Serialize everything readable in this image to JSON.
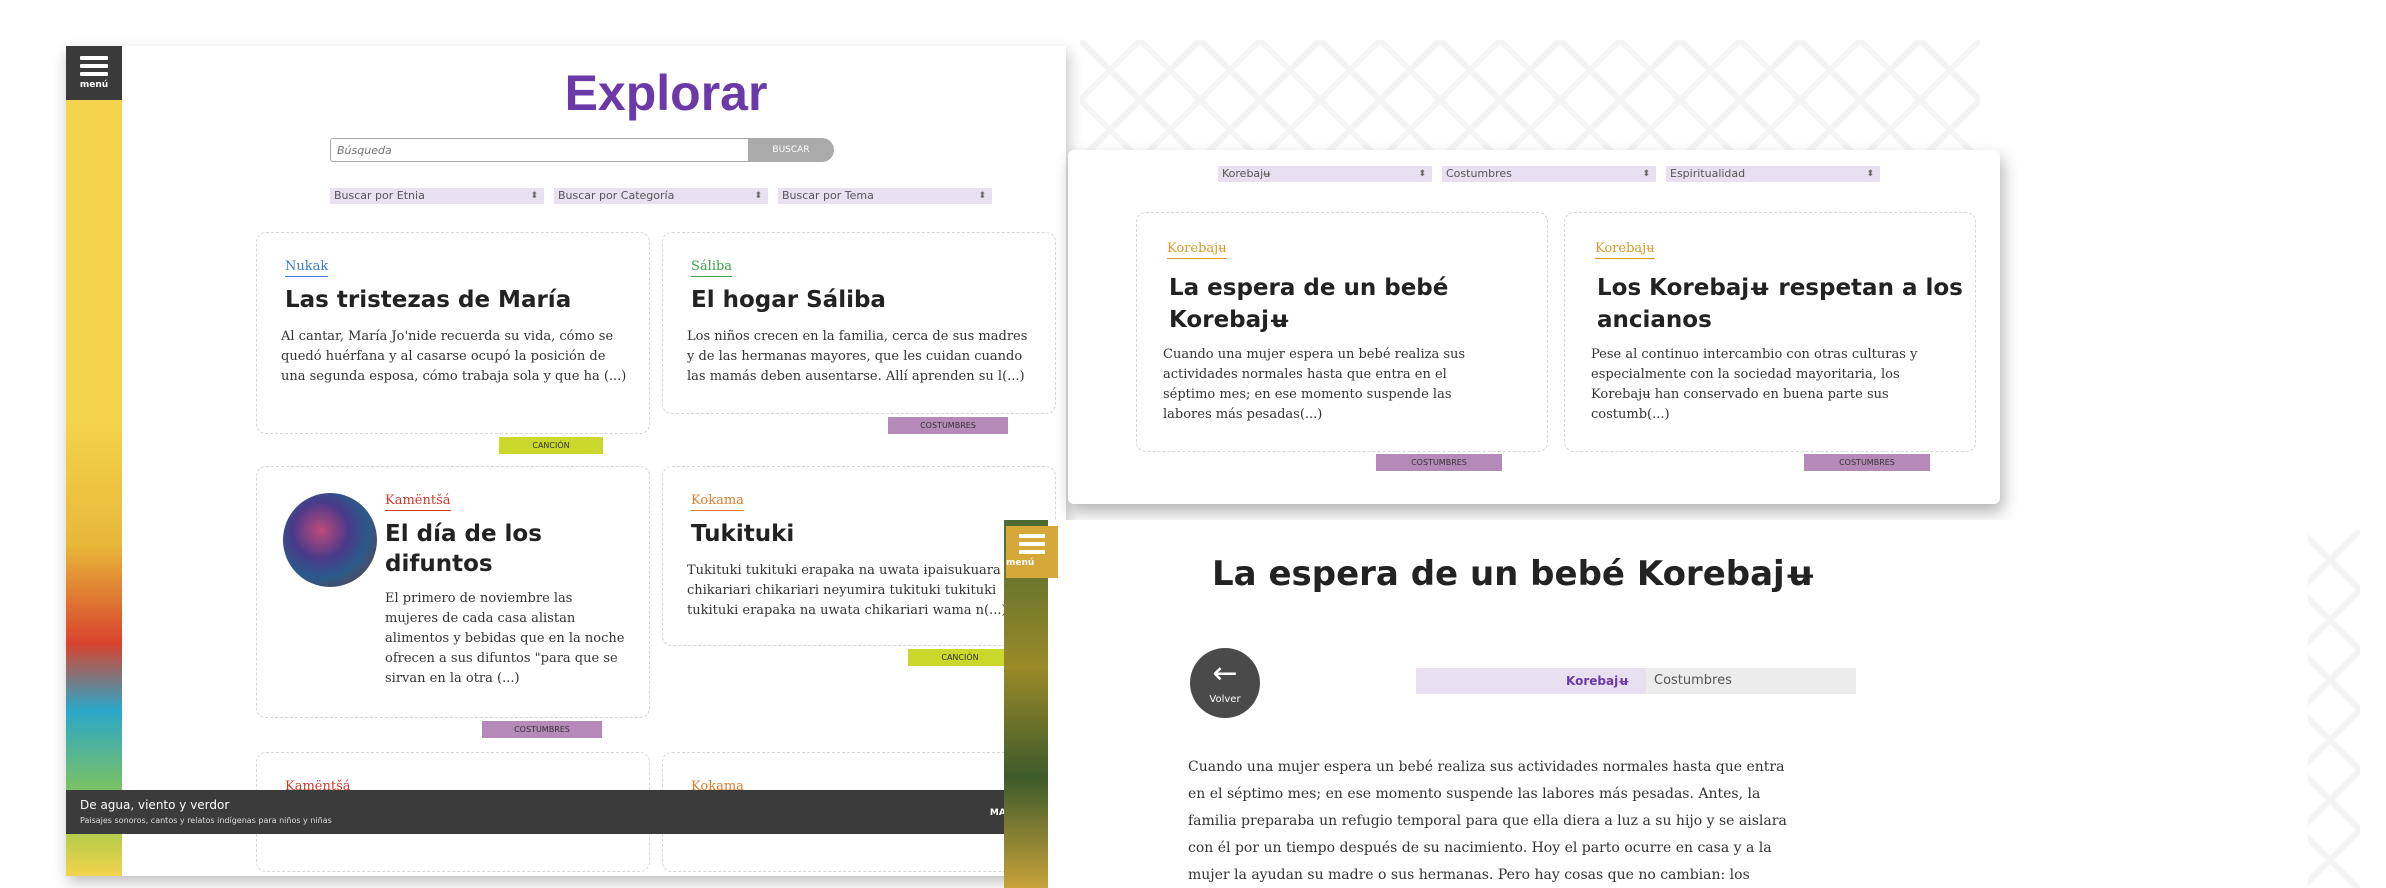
{
  "explore": {
    "menu_label": "menú",
    "title": "Explorar",
    "search_placeholder": "Búsqueda",
    "search_button": "BUSCAR",
    "filters": [
      "Buscar por Etnia",
      "Buscar por Categoría",
      "Buscar por Tema"
    ],
    "cards": [
      {
        "ethnic": "Nukak",
        "title": "Las tristezas de María",
        "text": "Al cantar, María Jo'nide recuerda su vida, cómo se quedó huérfana y al casarse ocupó la posición de una segunda esposa, cómo trabaja sola y que ha (...)",
        "tag": "CANCIÓN"
      },
      {
        "ethnic": "Sáliba",
        "title": "El hogar Sáliba",
        "text": "Los niños crecen en la familia, cerca de sus madres y de las hermanas mayores, que les cuidan cuando las mamás deben ausentarse. Allí aprenden su l(...)",
        "tag": "COSTUMBRES"
      },
      {
        "ethnic": "Kamëntšá",
        "title": "El día de los difuntos",
        "text": "El primero de noviembre las mujeres de cada casa alistan alimentos y bebidas que en la noche ofrecen a sus difuntos \"para que se sirvan en la otra (...)",
        "tag": "COSTUMBRES"
      },
      {
        "ethnic": "Kokama",
        "title": "Tukituki",
        "text": "Tukituki tukituki erapaka na uwata ɨpaisukuara chikariari chikariari neyumira tukituki tukituki tukituki erapaka na uwata chikariari wama n(...)",
        "tag": "CANCIÓN"
      }
    ],
    "bottom_cards": [
      {
        "ethnic": "Kamëntšá"
      },
      {
        "ethnic": "Kokama"
      }
    ],
    "footer": {
      "title": "De agua, viento y verdor",
      "subtitle": "Paisajes sonoros, cantos y relatos indígenas para niños y niñas",
      "link": "MAPA DEL SI"
    }
  },
  "filtered": {
    "filters": [
      "Korebajʉ",
      "Costumbres",
      "Espiritualidad"
    ],
    "cards": [
      {
        "ethnic": "Korebajʉ",
        "title_line1": "La espera de un bebé",
        "title_line2": "Korebajʉ",
        "text": "Cuando una mujer espera un bebé realiza sus actividades normales hasta que entra en el séptimo mes; en ese momento suspende las labores más pesadas(...)",
        "tag": "COSTUMBRES"
      },
      {
        "ethnic": "Korebajʉ",
        "title_line1": "Los Korebajʉ respetan a los",
        "title_line2": "ancianos",
        "text": "Pese al continuo intercambio con otras culturas y especialmente con la sociedad mayoritaria, los Korebajʉ han conservado en buena parte sus costumb(...)",
        "tag": "COSTUMBRES"
      }
    ]
  },
  "detail": {
    "menu_label": "menú",
    "title": "La espera de un bebé Korebajʉ",
    "back_label": "Volver",
    "tag_ethnic": "Korebajʉ",
    "tag_category": "Costumbres",
    "body": [
      "Cuando una mujer espera un bebé realiza sus actividades normales hasta que entra",
      "en el séptimo mes; en ese momento suspende las labores más pesadas. Antes, la",
      "familia preparaba un refugio temporal para que ella diera a luz a su hijo y se aislara",
      "con él por un tiempo después de su nacimiento. Hoy el parto ocurre en casa y a la",
      "mujer la ayudan su madre o sus hermanas. Pero hay cosas que no cambian: los"
    ]
  },
  "colors": {
    "title_purple": "#6b3aa8",
    "tag_green": "#c9d82a",
    "tag_purple": "#b58ab8",
    "ethnic_nukak": "#3a7ad0",
    "ethnic_saliba": "#3aa04a",
    "ethnic_kamentsa": "#d0382c",
    "ethnic_kokama": "#e07a2a",
    "ethnic_korebaju": "#d89a2a"
  }
}
